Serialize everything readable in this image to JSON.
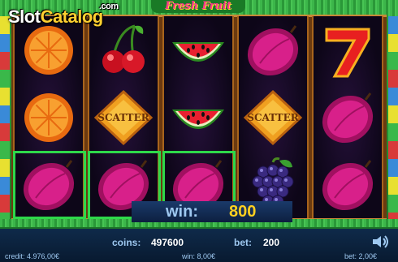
{
  "branding": {
    "logo_slot": "Slot",
    "logo_catalog": "Catalog",
    "logo_com": ".com",
    "game_title": "Fresh Fruit"
  },
  "reels": [
    [
      "orange",
      "orange",
      "plum"
    ],
    [
      "cherry",
      "scatter",
      "plum"
    ],
    [
      "watermelon",
      "watermelon",
      "plum"
    ],
    [
      "plum",
      "scatter",
      "grapes"
    ],
    [
      "seven",
      "plum",
      "plum"
    ]
  ],
  "scatter_label": "SCATTER",
  "win_banner": {
    "label": "win:",
    "value": "800"
  },
  "bottom_bar": {
    "coins_label": "coins:",
    "coins_value": "497600",
    "bet_label": "bet:",
    "bet_value": "200",
    "credit": "credit: 4.976,00€",
    "win": "win: 8,00€",
    "bet_money": "bet: 2,00€"
  },
  "icons": {
    "sound": "speaker-icon"
  }
}
